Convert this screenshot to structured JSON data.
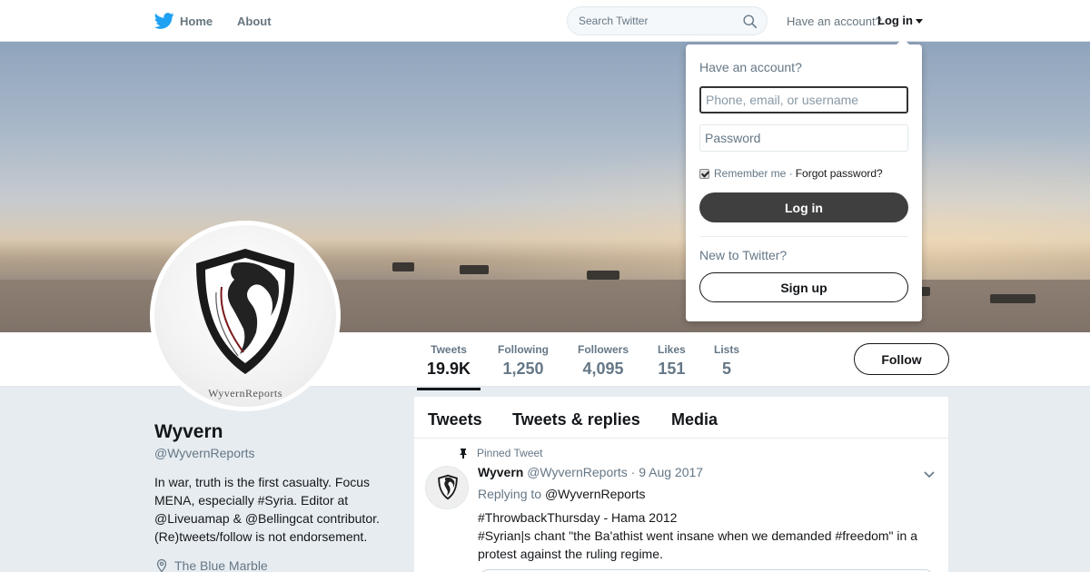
{
  "nav": {
    "home_label": "Home",
    "about_label": "About",
    "search_placeholder": "Search Twitter",
    "have_account": "Have an account?",
    "login_label": "Log in"
  },
  "profile": {
    "name": "Wyvern",
    "handle": "@WyvernReports",
    "bio": "In war, truth is the first casualty. Focus MENA, especially #Syria. Editor at @Liveuamap & @Bellingcat contributor. (Re)tweets/follow is not endorsement.",
    "location": "The Blue Marble",
    "avatar_brand": "WyvernReports"
  },
  "stats": [
    {
      "label": "Tweets",
      "value": "19.9K"
    },
    {
      "label": "Following",
      "value": "1,250"
    },
    {
      "label": "Followers",
      "value": "4,095"
    },
    {
      "label": "Likes",
      "value": "151"
    },
    {
      "label": "Lists",
      "value": "5"
    }
  ],
  "follow_label": "Follow",
  "timeline": {
    "tabs": [
      "Tweets",
      "Tweets & replies",
      "Media"
    ],
    "tweet": {
      "pinned_label": "Pinned Tweet",
      "name": "Wyvern",
      "handle": "@WyvernReports",
      "date": "· 9 Aug 2017",
      "replying_to": "Replying to",
      "reply_mention": "@WyvernReports",
      "line1": "#ThrowbackThursday - Hama 2012",
      "line2": "#Syrian|s chant \"the Ba'athist went insane when we demanded #freedom\" in a protest against the ruling regime."
    }
  },
  "login_dropdown": {
    "title": "Have an account?",
    "username_placeholder": "Phone, email, or username",
    "password_placeholder": "Password",
    "remember_me": "Remember me ·",
    "forgot_password": "Forgot password?",
    "login_button": "Log in",
    "new_to_twitter": "New to Twitter?",
    "signup_button": "Sign up"
  },
  "colors": {
    "text_primary": "#14171a",
    "text_secondary": "#657786",
    "background": "#e6ecf0",
    "login_button": "#3f3f3f",
    "twitter_blue": "#1da1f2"
  }
}
